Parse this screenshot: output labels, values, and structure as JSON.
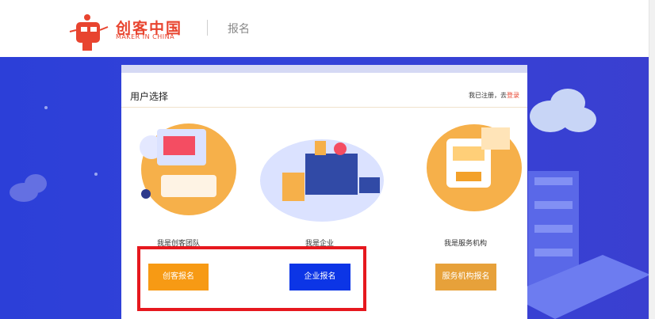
{
  "header": {
    "logo_text": "创客中国",
    "logo_sub": "MAKER IN CHINA",
    "title": "报名"
  },
  "panel": {
    "title": "用户选择",
    "login_prefix": "我已注册，去",
    "login_link": "登录"
  },
  "options": [
    {
      "label": "我是创客团队",
      "button": "创客报名"
    },
    {
      "label": "我是企业",
      "button": "企业报名"
    },
    {
      "label": "我是服务机构",
      "button": "服务机构报名"
    }
  ],
  "colors": {
    "brand": "#e8442f",
    "background": "#3343d9",
    "orange_button": "#f79a14",
    "blue_button": "#0c35e6",
    "gold_button": "#e7a13a",
    "highlight_box": "#e6181e"
  }
}
